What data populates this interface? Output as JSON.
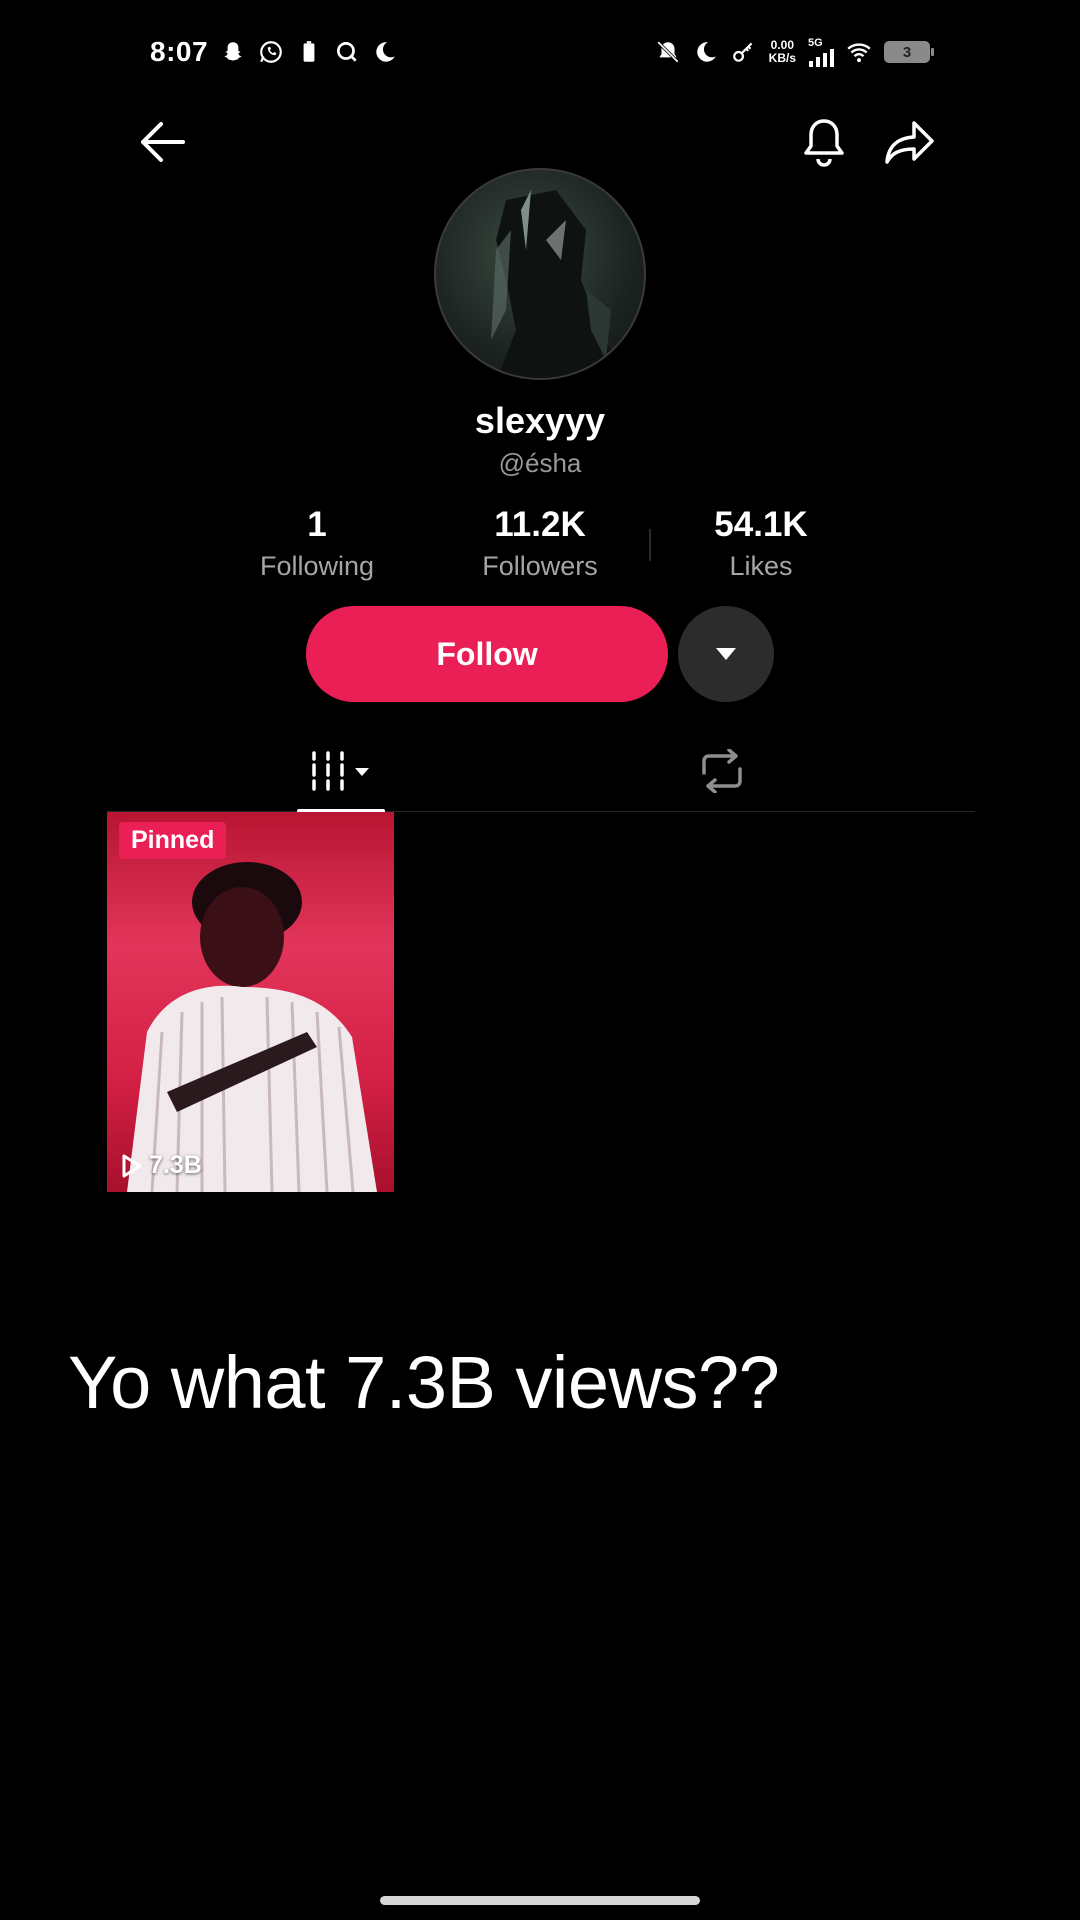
{
  "status_bar": {
    "time": "8:07",
    "net_speed_value": "0.00",
    "net_speed_unit": "KB/s",
    "network_type": "5G",
    "battery_level": "3",
    "left_icons": [
      "snapchat-icon",
      "whatsapp-icon",
      "battery-saver-icon",
      "q-app-icon",
      "moon-icon"
    ],
    "right_icons": [
      "mute-bell-icon",
      "moon-icon",
      "key-icon",
      "signal-icon",
      "wifi-icon"
    ]
  },
  "nav": {
    "back_icon": "arrow-left-icon",
    "bell_icon": "bell-icon",
    "share_icon": "share-icon"
  },
  "profile": {
    "username": "slexyyy",
    "handle": "@ésha",
    "stats": [
      {
        "value": "1",
        "label": "Following"
      },
      {
        "value": "11.2K",
        "label": "Followers"
      },
      {
        "value": "54.1K",
        "label": "Likes"
      }
    ],
    "follow_label": "Follow",
    "accent_color": "#ea1f55"
  },
  "tabs": {
    "videos_icon": "grid-icon",
    "reposts_icon": "repost-icon"
  },
  "videos": [
    {
      "badge": "Pinned",
      "views": "7.3B"
    }
  ],
  "caption": "Yo what 7.3B views??"
}
